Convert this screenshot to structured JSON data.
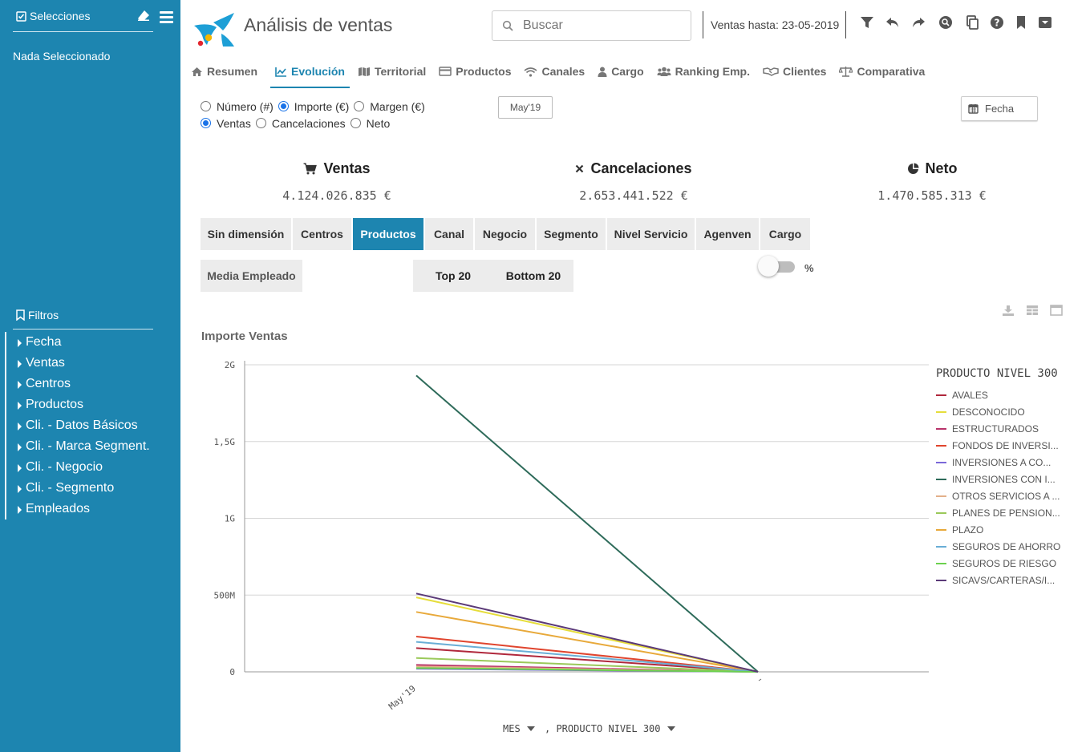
{
  "sidebar": {
    "title": "Selecciones",
    "nothing_selected": "Nada Seleccionado",
    "filters_title": "Filtros",
    "filters": [
      "Fecha",
      "Ventas",
      "Centros",
      "Productos",
      "Cli. - Datos Básicos",
      "Cli. - Marca Segment.",
      "Cli. - Negocio",
      "Cli. - Segmento",
      "Empleados"
    ]
  },
  "header": {
    "title": "Análisis de ventas",
    "search_placeholder": "Buscar",
    "ventas_hasta": "Ventas hasta: 23-05-2019",
    "tools": [
      "filter-icon",
      "undo-icon",
      "redo-icon",
      "search-circle-icon",
      "copy-icon",
      "help-icon",
      "bookmark-icon",
      "dropdown-box-icon"
    ]
  },
  "tabs": [
    {
      "label": "Resumen",
      "icon": "home-icon",
      "active": false
    },
    {
      "label": "Evolución",
      "icon": "line-chart-icon",
      "active": true
    },
    {
      "label": "Territorial",
      "icon": "map-icon",
      "active": false
    },
    {
      "label": "Productos",
      "icon": "credit-card-icon",
      "active": false
    },
    {
      "label": "Canales",
      "icon": "wifi-icon",
      "active": false
    },
    {
      "label": "Cargo",
      "icon": "user-icon",
      "active": false
    },
    {
      "label": "Ranking Emp.",
      "icon": "users-icon",
      "active": false
    },
    {
      "label": "Clientes",
      "icon": "handshake-icon",
      "active": false
    },
    {
      "label": "Comparativa",
      "icon": "balance-icon",
      "active": false
    }
  ],
  "radios": {
    "measure": {
      "options": [
        "Número (#)",
        "Importe (€)",
        "Margen (€)"
      ],
      "selected": 1
    },
    "type": {
      "options": [
        "Ventas",
        "Cancelaciones",
        "Neto"
      ],
      "selected": 0
    }
  },
  "period_button": "May'19",
  "date_button": "Fecha",
  "kpis": [
    {
      "title": "Ventas",
      "icon": "cart-icon",
      "value": "4.124.026.835 €"
    },
    {
      "title": "Cancelaciones",
      "icon": "times-icon",
      "value": "2.653.441.522 €"
    },
    {
      "title": "Neto",
      "icon": "pie-chart-icon",
      "value": "1.470.585.313 €"
    }
  ],
  "dimensions": {
    "items": [
      "Sin dimensión",
      "Centros",
      "Productos",
      "Canal",
      "Negocio",
      "Segmento",
      "Nivel Servicio",
      "Agenven",
      "Cargo"
    ],
    "active": 2
  },
  "media_empleado": "Media Empleado",
  "top_label": "Top 20",
  "bottom_label": "Bottom 20",
  "percent_toggle": {
    "label": "%",
    "on": false
  },
  "chart_data": {
    "type": "line",
    "title": "Importe Ventas",
    "x": [
      "May'19",
      ""
    ],
    "ylim": [
      0,
      2000000000
    ],
    "yticks": [
      0,
      500000000,
      1000000000,
      1500000000,
      2000000000
    ],
    "ytick_labels": [
      "0",
      "500M",
      "1G",
      "1,5G",
      "2G"
    ],
    "grid": true,
    "legend_title": "PRODUCTO NIVEL 300",
    "legend_position": "right",
    "series": [
      {
        "name": "AVALES",
        "color": "#b0283c",
        "values": [
          155000000,
          0
        ]
      },
      {
        "name": "DESCONOCIDO",
        "color": "#e6dd3b",
        "values": [
          485000000,
          0
        ]
      },
      {
        "name": "ESTRUCTURADOS",
        "color": "#b8336a",
        "values": [
          45000000,
          0
        ]
      },
      {
        "name": "FONDOS DE INVERSI...",
        "color": "#e0452e",
        "values": [
          230000000,
          0
        ]
      },
      {
        "name": "INVERSIONES A CO...",
        "color": "#7b68d9",
        "values": [
          20000000,
          0
        ]
      },
      {
        "name": "INVERSIONES CON I...",
        "color": "#2e6b5a",
        "values": [
          1930000000,
          0
        ]
      },
      {
        "name": "OTROS SERVICIOS A ...",
        "color": "#e3b08a",
        "values": [
          35000000,
          0
        ]
      },
      {
        "name": "PLANES DE PENSION...",
        "color": "#9bc95a",
        "values": [
          90000000,
          0
        ]
      },
      {
        "name": "PLAZO",
        "color": "#e8a93a",
        "values": [
          390000000,
          0
        ]
      },
      {
        "name": "SEGUROS DE AHORRO",
        "color": "#6aaed6",
        "values": [
          195000000,
          0
        ]
      },
      {
        "name": "SEGUROS DE RIESGO",
        "color": "#6cd14e",
        "values": [
          25000000,
          0
        ]
      },
      {
        "name": "SICAVS/CARTERAS/I...",
        "color": "#5b3a78",
        "values": [
          510000000,
          0
        ]
      }
    ]
  },
  "x_selectors": [
    "MES",
    ", PRODUCTO NIVEL 300"
  ],
  "colors": {
    "sidebar": "#1d85b0",
    "accent": "#1d85b0"
  }
}
